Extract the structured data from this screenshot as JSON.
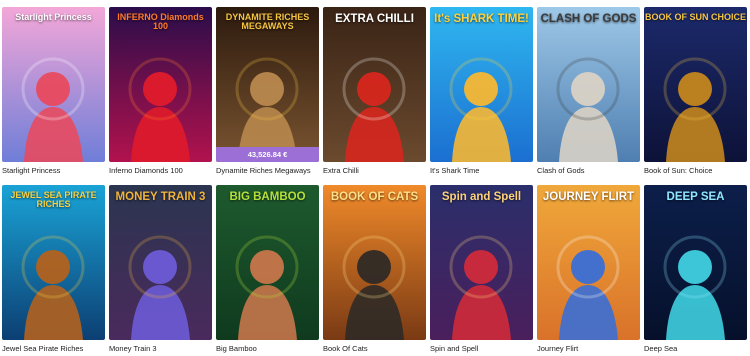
{
  "games": [
    {
      "name": "Starlight Princess",
      "logo": "Starlight Princess",
      "bg_top": "#f3a7d8",
      "bg_bottom": "#6f7ed8",
      "accent": "#ffffff",
      "figure": "#e84a5f"
    },
    {
      "name": "Inferno Diamonds 100",
      "logo": "INFERNO Diamonds 100",
      "bg_top": "#2a0d4a",
      "bg_bottom": "#b2124d",
      "accent": "#ff7a2a",
      "figure": "#e01b2b"
    },
    {
      "name": "Dynamite Riches Megaways",
      "logo": "DYNAMITE RICHES MEGAWAYS",
      "bg_top": "#2c1a0e",
      "bg_bottom": "#7a5430",
      "accent": "#f5c542",
      "figure": "#b8884e",
      "jackpot": "43,526.84 €"
    },
    {
      "name": "Extra Chilli",
      "logo": "EXTRA CHILLI",
      "bg_top": "#3a2416",
      "bg_bottom": "#6b4a2e",
      "accent": "#ffffff",
      "figure": "#d7261e"
    },
    {
      "name": "It's Shark Time",
      "logo": "It's SHARK TIME!",
      "bg_top": "#2fb7f0",
      "bg_bottom": "#1b6fd0",
      "accent": "#ffd23b",
      "figure": "#f7b733"
    },
    {
      "name": "Clash of Gods",
      "logo": "CLASH OF GODS",
      "bg_top": "#9ec8e8",
      "bg_bottom": "#4f7fb1",
      "accent": "#3a3a3a",
      "figure": "#d9d2c5"
    },
    {
      "name": "Book of Sun: Choice",
      "logo": "BOOK OF SUN CHOICE",
      "bg_top": "#1c2a6b",
      "bg_bottom": "#0d1238",
      "accent": "#f5c542",
      "figure": "#c4861e"
    },
    {
      "name": "Jewel Sea Pirate Riches",
      "logo": "JEWEL SEA PIRATE RICHES",
      "bg_top": "#1aa3d6",
      "bg_bottom": "#0c3f73",
      "accent": "#f5d142",
      "figure": "#b3621e"
    },
    {
      "name": "Money Train 3",
      "logo": "MONEY TRAIN 3",
      "bg_top": "#2b3550",
      "bg_bottom": "#4a2a5c",
      "accent": "#f0b43b",
      "figure": "#6b5bd6"
    },
    {
      "name": "Big Bamboo",
      "logo": "BIG BAMBOO",
      "bg_top": "#1e5a2e",
      "bg_bottom": "#0f3a1e",
      "accent": "#b6e03b",
      "figure": "#c7764a"
    },
    {
      "name": "Book Of Cats",
      "logo": "BOOK OF CATS",
      "bg_top": "#f08a2a",
      "bg_bottom": "#7a3a14",
      "accent": "#ffe08a",
      "figure": "#2f2a26"
    },
    {
      "name": "Spin and Spell",
      "logo": "Spin and Spell",
      "bg_top": "#2a2f6b",
      "bg_bottom": "#4a1f5c",
      "accent": "#ffd27a",
      "figure": "#cf2a3a"
    },
    {
      "name": "Journey Flirt",
      "logo": "JOURNEY FLIRT",
      "bg_top": "#f0a83a",
      "bg_bottom": "#d9722a",
      "accent": "#ffffff",
      "figure": "#3a6fd6"
    },
    {
      "name": "Deep Sea",
      "logo": "DEEP SEA",
      "bg_top": "#0c1f4a",
      "bg_bottom": "#06102b",
      "accent": "#8fe8ff",
      "figure": "#3fd0e0"
    }
  ]
}
